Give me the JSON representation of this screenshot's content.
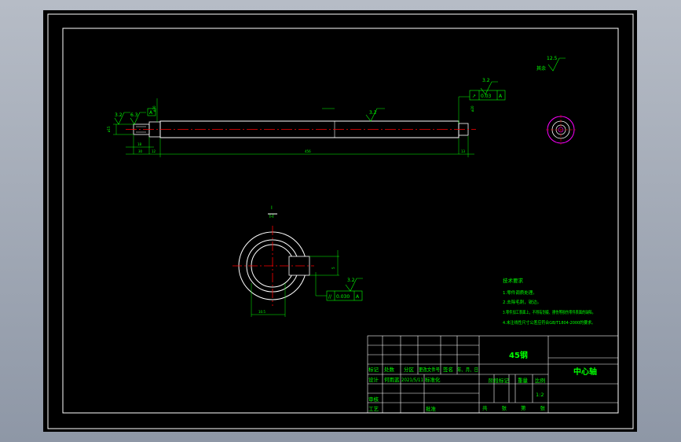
{
  "drawing": {
    "part_name": "中心轴",
    "material": "45钢",
    "scale": "1:2",
    "surface_roughness": {
      "general": "12.5",
      "general_note": "其余",
      "end_left_1": "3.2",
      "end_left_2": "6.3",
      "body": "3.2",
      "right_end": "3.2",
      "section": "3.2"
    },
    "geometric_tolerance": {
      "right": {
        "symbol": "↗",
        "value": "0.03",
        "datum": "A"
      },
      "section": {
        "symbol": "//",
        "value": "0.030",
        "datum": "A"
      }
    },
    "datum_label": "A",
    "section_label": "I-I",
    "section_cut_mark": "I",
    "dimensions": {
      "overall_length": "456",
      "left_step": "30",
      "left_step_2": "12",
      "right_step": "13",
      "left_small": "18",
      "diameter_left": "ø15",
      "key_width": "10.5",
      "key_depth": "5",
      "diameter_body": "ø30",
      "diameter_end": "ø20"
    },
    "technical_requirements": {
      "title": "技术要求",
      "items": [
        "1.零件调质处理。",
        "2.去除毛刺，锐边。",
        "3.零件加工表面上，不得有划痕、擦伤等损伤零件表面的缺陷。",
        "4.未注线性尺寸公差应符合GB/T1804-2000的要求。"
      ]
    },
    "title_block": {
      "row_labels": {
        "mark": "标记",
        "count": "处数",
        "zone": "分区",
        "change_doc": "更改文件号",
        "sign": "签名",
        "date": "年、月、日"
      },
      "design_label": "设计",
      "designer": "何雨蓝",
      "design_date": "2021/5/11",
      "standardize_label": "标准化",
      "review_label": "审核",
      "process_label": "工艺",
      "approve_label": "批准",
      "stage_mark_label": "阶段标记",
      "weight_label": "重量",
      "scale_label": "比例",
      "sheet_info": "共  张  第  张"
    }
  },
  "colors": {
    "sheet": "#000000",
    "border": "#ffffff",
    "outline": "#ffffff",
    "centerline": "#ff0000",
    "dimension": "#00ff00",
    "magenta": "#ff00ff",
    "text": "#00ff00"
  }
}
